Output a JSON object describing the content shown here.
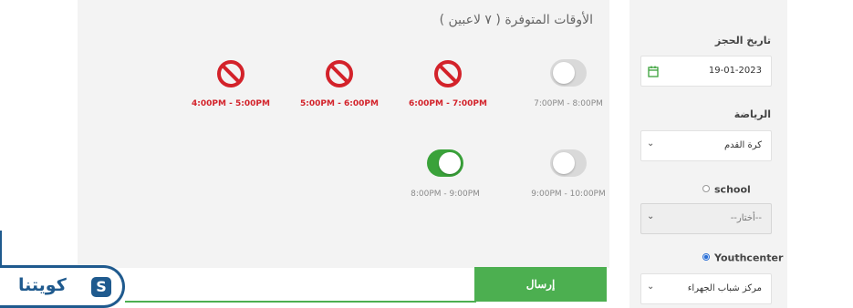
{
  "slots_title": "الأوقات المتوفرة ( ٧ لاعبين )",
  "slots": [
    {
      "time": "7:00PM - 8:00PM",
      "status": "available",
      "selected": false
    },
    {
      "time": "6:00PM - 7:00PM",
      "status": "booked"
    },
    {
      "time": "5:00PM - 6:00PM",
      "status": "booked"
    },
    {
      "time": "4:00PM - 5:00PM",
      "status": "booked"
    },
    {
      "time": "9:00PM - 10:00PM",
      "status": "available",
      "selected": false
    },
    {
      "time": "8:00PM - 9:00PM",
      "status": "available",
      "selected": true
    }
  ],
  "sidebar": {
    "date_label": "تاريخ الحجز",
    "date_value": "19-01-2023",
    "sport_label": "الرياضة",
    "sport_value": "كرة القدم",
    "school_option": "school",
    "school_value": "--أختار--",
    "youth_option": "Youthcenter",
    "youth_value": "مركز شباب الجهراء"
  },
  "submit_label": "إرسال",
  "logo_text": "كويتنا",
  "colors": {
    "accent": "#4caf50",
    "booked": "#d3222a",
    "brand": "#1f5a8e"
  }
}
